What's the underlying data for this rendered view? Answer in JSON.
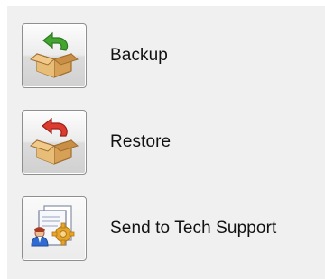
{
  "actions": [
    {
      "label": "Backup",
      "icon": "box-green-arrow-icon"
    },
    {
      "label": "Restore",
      "icon": "box-red-arrow-icon"
    },
    {
      "label": "Send to Tech Support",
      "icon": "support-document-icon"
    }
  ],
  "colors": {
    "panel_bg": "#f0f0f0",
    "box_tan": "#d9a35a",
    "arrow_green": "#3f9f2b",
    "arrow_red": "#d83a2e",
    "gear_orange": "#e3a22b"
  }
}
